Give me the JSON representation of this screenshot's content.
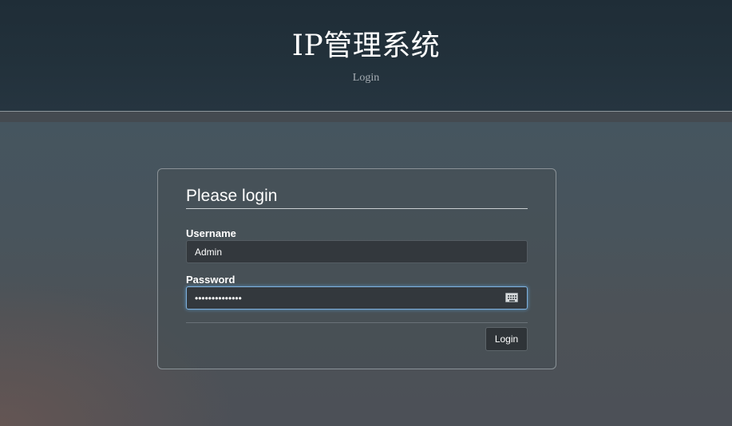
{
  "header": {
    "title": "IP管理系统",
    "subtitle": "Login"
  },
  "login_form": {
    "title": "Please login",
    "username_label": "Username",
    "username_value": "Admin",
    "password_label": "Password",
    "password_value": "••••••••••••••",
    "submit_label": "Login"
  },
  "icons": {
    "password_field": "keyboard-icon"
  }
}
